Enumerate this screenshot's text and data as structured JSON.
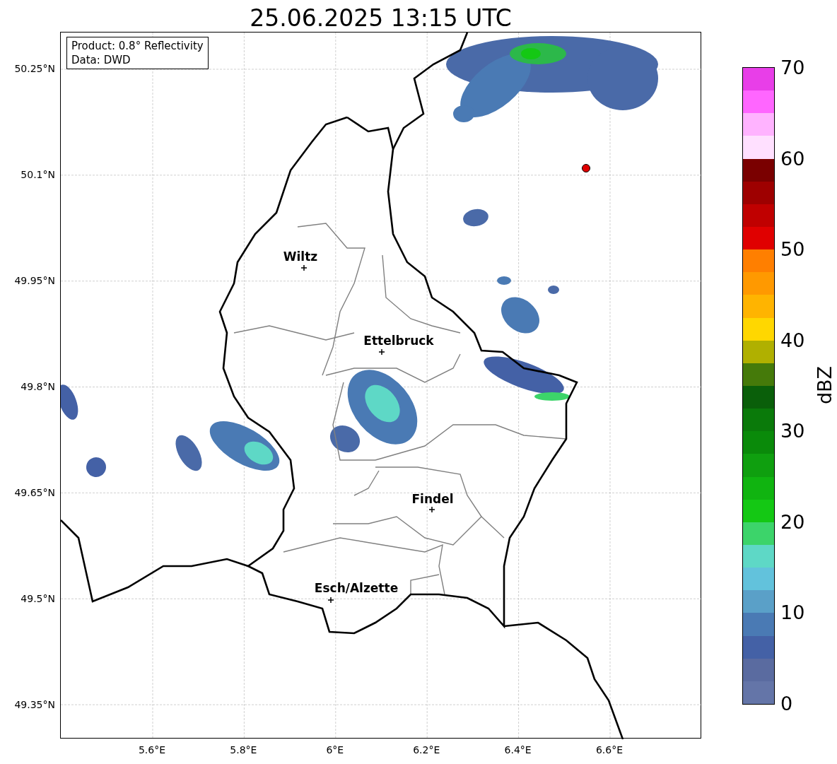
{
  "title": "25.06.2025 13:15 UTC",
  "info_box": [
    "Product: 0.8° Reflectivity",
    "Data: DWD"
  ],
  "y_ticks": [
    "50.25°N",
    "50.1°N",
    "49.95°N",
    "49.8°N",
    "49.65°N",
    "49.5°N",
    "49.35°N"
  ],
  "x_ticks": [
    "5.6°E",
    "5.8°E",
    "6°E",
    "6.2°E",
    "6.4°E",
    "6.6°E"
  ],
  "cities": [
    {
      "name": "Wiltz"
    },
    {
      "name": "Ettelbruck"
    },
    {
      "name": "Findel"
    },
    {
      "name": "Esch/Alzette"
    }
  ],
  "colorbar": {
    "label": "dBZ",
    "ticks": [
      "70",
      "60",
      "50",
      "40",
      "30",
      "20",
      "10",
      "0"
    ],
    "bands": [
      {
        "color": "#e83ee8"
      },
      {
        "color": "#ff66ff"
      },
      {
        "color": "#ffb3ff"
      },
      {
        "color": "#ffe0ff"
      },
      {
        "color": "#7a0000"
      },
      {
        "color": "#9e0000"
      },
      {
        "color": "#c00000"
      },
      {
        "color": "#e00000"
      },
      {
        "color": "#ff7f00"
      },
      {
        "color": "#ff9900"
      },
      {
        "color": "#ffb400"
      },
      {
        "color": "#ffd700"
      },
      {
        "color": "#b0b000"
      },
      {
        "color": "#457a0a"
      },
      {
        "color": "#0a5f0a"
      },
      {
        "color": "#0a7a0a"
      },
      {
        "color": "#0a8a0a"
      },
      {
        "color": "#0f9f0f"
      },
      {
        "color": "#10b410"
      },
      {
        "color": "#14c814"
      },
      {
        "color": "#3cd46a"
      },
      {
        "color": "#5ed8c6"
      },
      {
        "color": "#62c2dc"
      },
      {
        "color": "#5aa0c8"
      },
      {
        "color": "#4a7ab4"
      },
      {
        "color": "#4461a6"
      },
      {
        "color": "#5a6ba0"
      },
      {
        "color": "#6475a8"
      }
    ]
  }
}
